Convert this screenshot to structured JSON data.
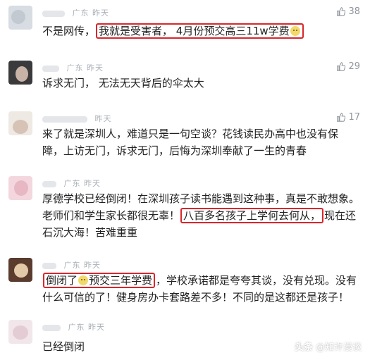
{
  "comments": [
    {
      "location": "广东",
      "time": "昨天",
      "likes": "38",
      "segments": [
        {
          "t": "不是网传，",
          "hl": false
        },
        {
          "t": "我就是受害者， 4月份预交高三11w学费",
          "hl": true
        }
      ]
    },
    {
      "location": "广东",
      "time": "昨天",
      "likes": "29",
      "segments": [
        {
          "t": "诉求无门， 无法无天背后的伞太大",
          "hl": false
        }
      ]
    },
    {
      "location": "",
      "time": "昨天",
      "likes": "17",
      "segments": [
        {
          "t": "来了就是深圳人，难道只是一句空谈？花钱读民办高中也没有保障，上访无门，诉求无门，后悔为深圳奉献了一生的青春",
          "hl": false
        }
      ]
    },
    {
      "location": "广东",
      "time": "昨天",
      "likes": "",
      "segments": [
        {
          "t": "厚德学校已经倒闭！在深圳孩子读书能遇到这种事，真是不敢想象。老师们和学生家长都很无辜！",
          "hl": false
        },
        {
          "t": "八百多名孩子上学何去何从，",
          "hl": true
        },
        {
          "t": "现在还石沉大海！苦难重重",
          "hl": false
        }
      ]
    },
    {
      "location": "广东",
      "time": "昨天",
      "likes": "",
      "segments": [
        {
          "t": "倒闭了",
          "hl": true,
          "emoji": true
        },
        {
          "t": "预交三年学费",
          "hl": true
        },
        {
          "t": "，学校承诺都是夸夸其谈，没有兑现。没有什么可信的了！健身房办卡套路差不多！不同的是这都还是孩子！",
          "hl": false
        }
      ]
    },
    {
      "location": "广东",
      "time": "昨天",
      "likes": "",
      "segments": [
        {
          "t": "已经倒闭",
          "hl": false
        }
      ]
    }
  ],
  "watermark": {
    "brand": "头条",
    "handle": "@知许漫谈"
  },
  "colors": {
    "highlight": "#d9262b",
    "meta": "#aab0b8",
    "text": "#222222"
  }
}
